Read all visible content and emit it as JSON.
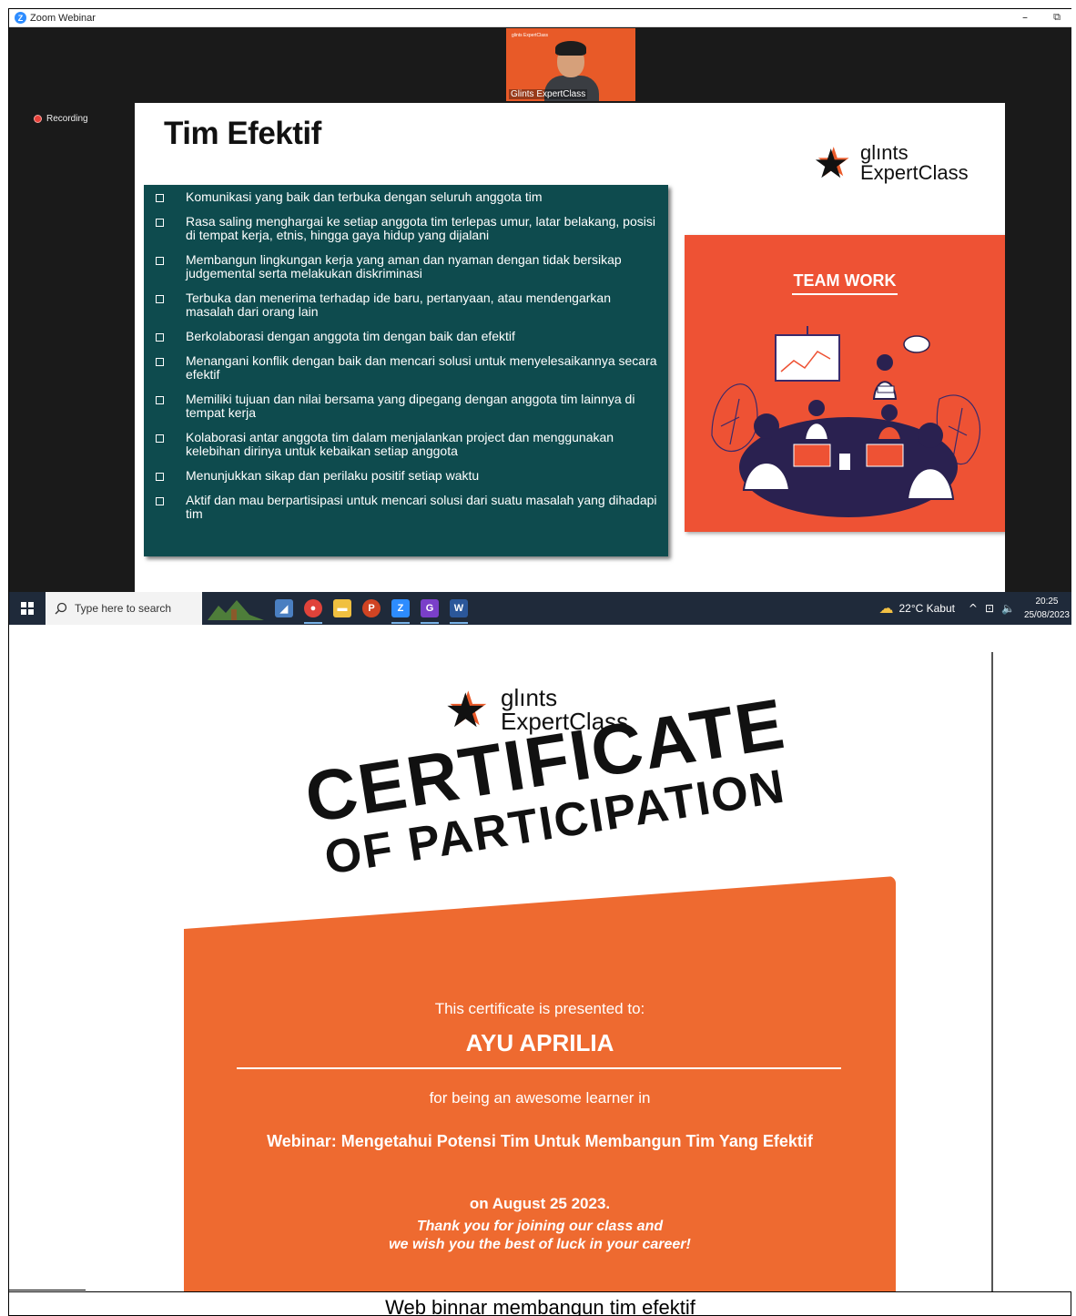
{
  "window": {
    "title": "Zoom Webinar",
    "minimize": "–",
    "restore": "⧉"
  },
  "video": {
    "name": "Glints ExpertClass",
    "mini_logo": "glints ExpertClass"
  },
  "recording": {
    "label": "Recording"
  },
  "slide": {
    "title": "Tim Efektif",
    "logo": {
      "word1": "glınts",
      "word2": "ExpertClass"
    },
    "items": [
      "Komunikasi yang baik dan terbuka dengan seluruh anggota tim",
      "Rasa saling menghargai ke setiap anggota tim terlepas umur, latar belakang, posisi di tempat kerja, etnis, hingga gaya hidup yang dijalani",
      "Membangun lingkungan kerja yang aman dan nyaman dengan tidak bersikap judgemental serta melakukan diskriminasi",
      "Terbuka dan menerima terhadap ide baru, pertanyaan, atau mendengarkan masalah dari orang lain",
      "Berkolaborasi dengan anggota tim dengan baik dan efektif",
      "Menangani konflik dengan baik dan mencari solusi untuk menyelesaikannya secara efektif",
      "Memiliki tujuan dan nilai bersama yang dipegang dengan anggota tim lainnya di tempat kerja",
      "Kolaborasi antar anggota tim dalam menjalankan project dan menggunakan kelebihan dirinya untuk kebaikan setiap anggota",
      "Menunjukkan sikap dan perilaku positif setiap waktu",
      "Aktif dan mau berpartisipasi untuk mencari solusi dari suatu masalah yang dihadapi tim"
    ],
    "card_title": "TEAM WORK"
  },
  "taskbar": {
    "search_placeholder": "Type here to search",
    "weather": "22°C  Kabut",
    "time": "20:25",
    "date": "25/08/2023",
    "apps": [
      {
        "name": "file-manager",
        "color": "#4a7fc1",
        "glyph": "◢"
      },
      {
        "name": "chrome",
        "color": "#e0433a",
        "glyph": "●"
      },
      {
        "name": "folder",
        "color": "#f0c040",
        "glyph": "▬"
      },
      {
        "name": "powerpoint",
        "color": "#d04423",
        "glyph": "P"
      },
      {
        "name": "zoom",
        "color": "#2d8cff",
        "glyph": "Z"
      },
      {
        "name": "pdf",
        "color": "#7a3fc9",
        "glyph": "G"
      },
      {
        "name": "word",
        "color": "#2b579a",
        "glyph": "W"
      }
    ]
  },
  "certificate": {
    "logo": {
      "word1": "glınts",
      "word2": "ExpertClass"
    },
    "heading1": "CERTIFICATE",
    "heading2": "OF PARTICIPATION",
    "presented": "This certificate is presented to:",
    "name": "AYU APRILIA",
    "for_text": "for being an awesome learner in",
    "course": "Webinar: Mengetahui Potensi Tim Untuk Membangun Tim Yang Efektif",
    "date": "on August 25 2023.",
    "thanks1": "Thank you for joining our class and",
    "thanks2": "we wish you the best of luck in your career!"
  },
  "caption": "Web binnar membangun tim efektif",
  "colors": {
    "accent": "#ee6a30",
    "teal": "#0e4b4e",
    "taskbar": "#1f2a3a"
  }
}
